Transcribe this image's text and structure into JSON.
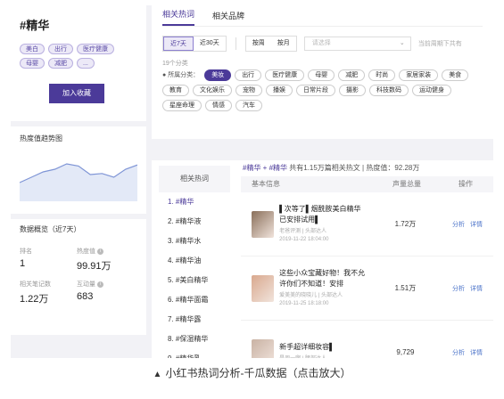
{
  "keyword": "#精华",
  "tags": [
    "美白",
    "出行",
    "医疗健康",
    "母婴",
    "减肥",
    "..."
  ],
  "fav_button": "加入收藏",
  "trend_title": "热度值趋势图",
  "trend_values": [
    0.35,
    0.45,
    0.55,
    0.6,
    0.7,
    0.66,
    0.5,
    0.52,
    0.45,
    0.6,
    0.68
  ],
  "overview_title": "数据概览（近7天）",
  "metrics": [
    {
      "label": "排名",
      "value": "1"
    },
    {
      "label": "热度值",
      "value": "99.91万",
      "info": true
    },
    {
      "label": "相关笔记数",
      "value": "1.22万"
    },
    {
      "label": "互动量",
      "value": "683",
      "info": true
    }
  ],
  "tabs": [
    {
      "label": "相关热词",
      "active": true
    },
    {
      "label": "相关品牌",
      "active": false
    }
  ],
  "range_seg": [
    {
      "label": "近7天",
      "on": true
    },
    {
      "label": "近30天",
      "on": false
    }
  ],
  "period_seg": [
    {
      "label": "按周",
      "on": false
    },
    {
      "label": "按月",
      "on": false
    }
  ],
  "select_placeholder": "请选择",
  "select_hint": "当前周期下共有",
  "category_count": "19个分类",
  "category_label": "所属分类：",
  "categories": [
    {
      "label": "美妆",
      "on": true
    },
    {
      "label": "出行"
    },
    {
      "label": "医疗健康"
    },
    {
      "label": "母婴"
    },
    {
      "label": "减肥"
    },
    {
      "label": "时尚"
    },
    {
      "label": "家居家装"
    },
    {
      "label": "美食"
    },
    {
      "label": "教育"
    },
    {
      "label": "文化娱乐"
    },
    {
      "label": "宠物"
    },
    {
      "label": "播娱"
    },
    {
      "label": "日常片段"
    },
    {
      "label": "摄影"
    },
    {
      "label": "科技数码"
    },
    {
      "label": "运动健身"
    },
    {
      "label": "星座命理"
    },
    {
      "label": "情感"
    },
    {
      "label": "汽车"
    }
  ],
  "related_header": "相关热词",
  "related_words": [
    "1. #精华",
    "2. #精华液",
    "3. #精华水",
    "4. #精华油",
    "5. #美白精华",
    "6. #精华面霜",
    "7. #精华露",
    "8. #保湿精华",
    "9. #精华乳"
  ],
  "summary": {
    "prefix": "#精华 + #精华",
    "text": " 共有1.15万篇相关热文 | 热度值：92.28万"
  },
  "table_headers": [
    "基本信息",
    "声量总量",
    "操作"
  ],
  "rows": [
    {
      "title": "▌次等了▌烟酰胺美白精华已安排试用▌",
      "author": "老爸评测 | 头部达人",
      "date": "2019-11-22 18:04:00",
      "volume": "1.72万",
      "color": "#8a6f5a"
    },
    {
      "title": "这些小众宝藏好物！我不允许你们不知道！安排",
      "author": "爱美美的晓晓儿 | 头部达人",
      "date": "2019-11-25 18:18:00",
      "volume": "1.51万",
      "color": "#d9a88e"
    },
    {
      "title": "新手超详细妆容▌",
      "author": "是周一啊 | 腰部达人",
      "date": "",
      "volume": "9,729",
      "color": "#c9b2a4"
    }
  ],
  "op_analysis": "分析",
  "op_detail": "详情",
  "caption": "小红书热词分析-千瓜数据（点击放大）"
}
